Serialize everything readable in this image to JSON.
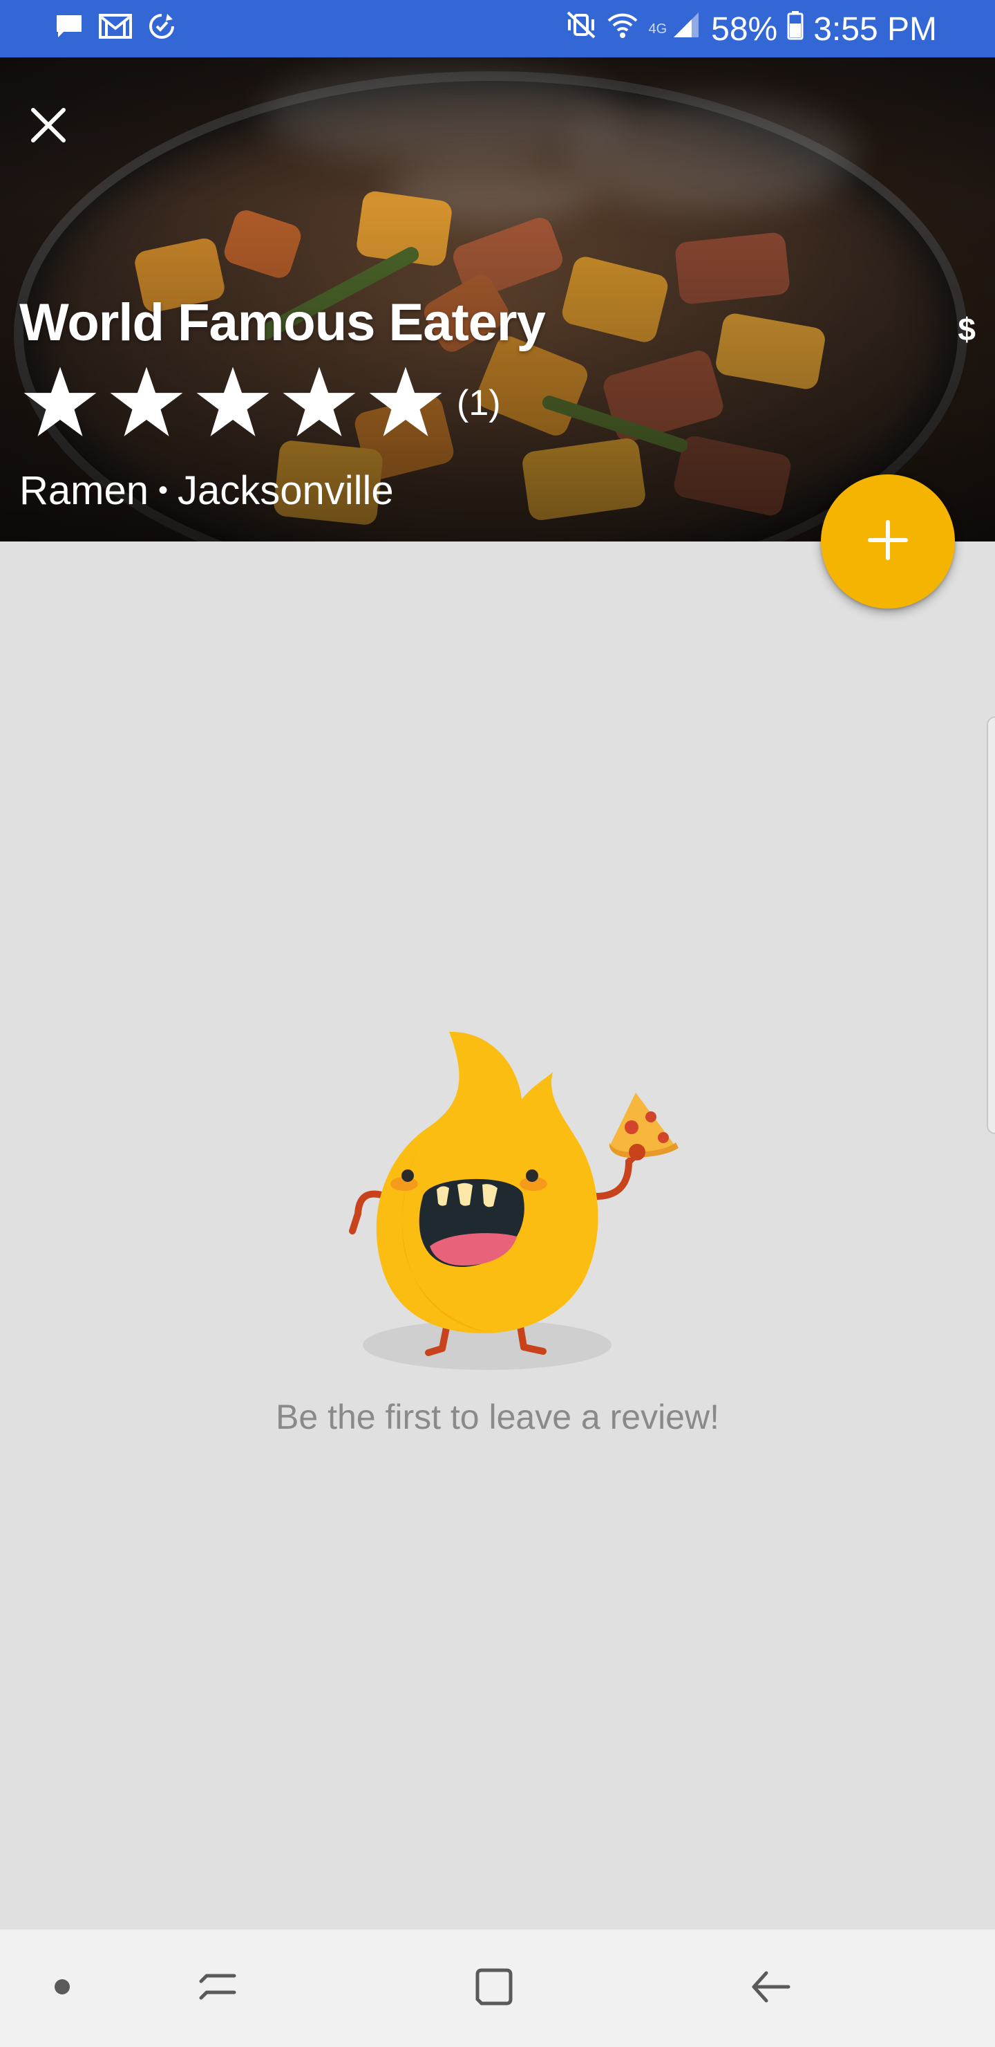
{
  "status_bar": {
    "battery": "58%",
    "time": "3:55 PM",
    "network": "4G",
    "left_icons": [
      "chat-icon",
      "gmail-icon",
      "sync-icon"
    ],
    "right_icons": [
      "vibrate-mute-icon",
      "wifi-icon",
      "signal-icon",
      "battery-icon"
    ]
  },
  "restaurant": {
    "name": "World Famous Eatery",
    "price": "$",
    "rating_stars": 5,
    "rating_count": "(1)",
    "category": "Ramen",
    "separator": "•",
    "city": "Jacksonville"
  },
  "actions": {
    "close_icon": "close-icon",
    "add_review_icon": "plus-icon"
  },
  "empty_state": {
    "message": "Be the first to leave a review!",
    "illustration": "flame-mascot-with-pizza"
  },
  "navigation": {
    "items": [
      "dot-icon",
      "recent-apps-icon",
      "home-icon",
      "back-icon"
    ]
  },
  "colors": {
    "status_bar": "#3367d6",
    "accent": "#f4b400",
    "background": "#e0e0e0",
    "nav_bar": "#f1f1f1",
    "empty_text": "#8a8a8a"
  }
}
